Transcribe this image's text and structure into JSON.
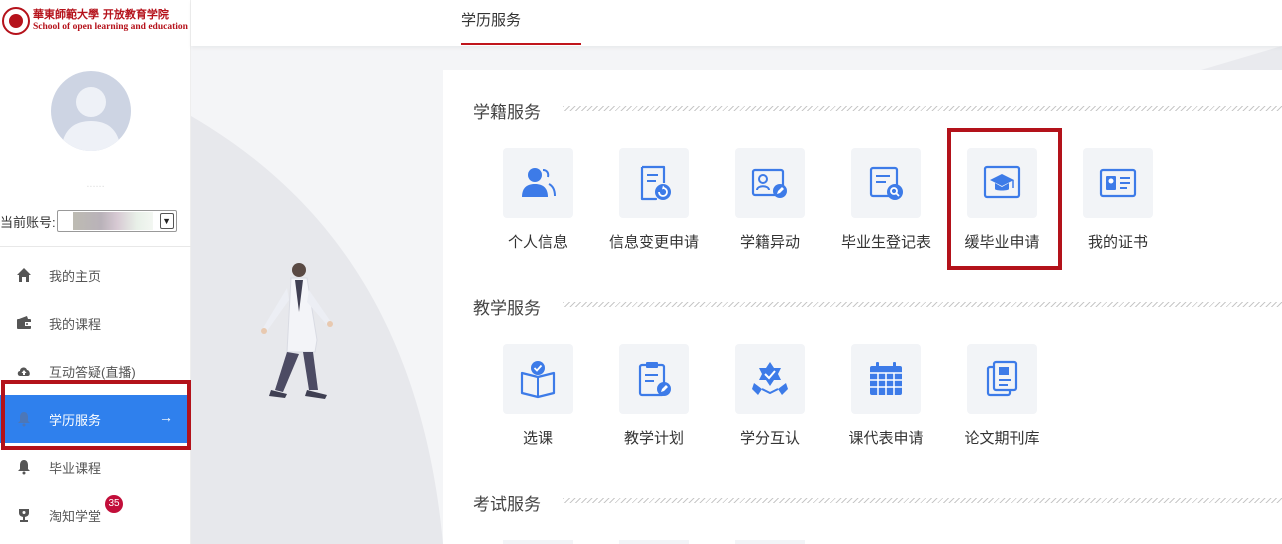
{
  "logo": {
    "line1": "華東師範大學 开放教育学院",
    "line2": "School of open learning and education"
  },
  "user": {
    "name": "......",
    "account_label": "当前账号:",
    "account_value": ""
  },
  "nav": [
    {
      "label": "我的主页",
      "icon": "home-icon"
    },
    {
      "label": "我的课程",
      "icon": "wallet-icon"
    },
    {
      "label": "互动答疑(直播)",
      "icon": "cloud-upload-icon"
    },
    {
      "label": "学历服务",
      "icon": "bell-icon",
      "active": true,
      "arrow": "→"
    },
    {
      "label": "毕业课程",
      "icon": "bell-icon"
    },
    {
      "label": "淘知学堂",
      "icon": "trophy-icon",
      "badge": "35"
    }
  ],
  "tabs": [
    {
      "label": "学历服务"
    }
  ],
  "sections": [
    {
      "title": "学籍服务",
      "items": [
        {
          "label": "个人信息",
          "icon": "users-icon"
        },
        {
          "label": "信息变更申请",
          "icon": "document-refresh-icon"
        },
        {
          "label": "学籍异动",
          "icon": "id-card-edit-icon"
        },
        {
          "label": "毕业生登记表",
          "icon": "document-search-icon"
        },
        {
          "label": "缓毕业申请",
          "icon": "graduation-cap-icon"
        },
        {
          "label": "我的证书",
          "icon": "certificate-card-icon"
        }
      ]
    },
    {
      "title": "教学服务",
      "items": [
        {
          "label": "选课",
          "icon": "book-check-icon"
        },
        {
          "label": "教学计划",
          "icon": "clipboard-edit-icon"
        },
        {
          "label": "学分互认",
          "icon": "award-handshake-icon"
        },
        {
          "label": "课代表申请",
          "icon": "calendar-icon"
        },
        {
          "label": "论文期刊库",
          "icon": "documents-icon"
        }
      ]
    },
    {
      "title": "考试服务",
      "items": []
    }
  ],
  "colors": {
    "accent": "#2f80ed",
    "brand_red": "#b5121b",
    "highlight": "#b3121a"
  }
}
